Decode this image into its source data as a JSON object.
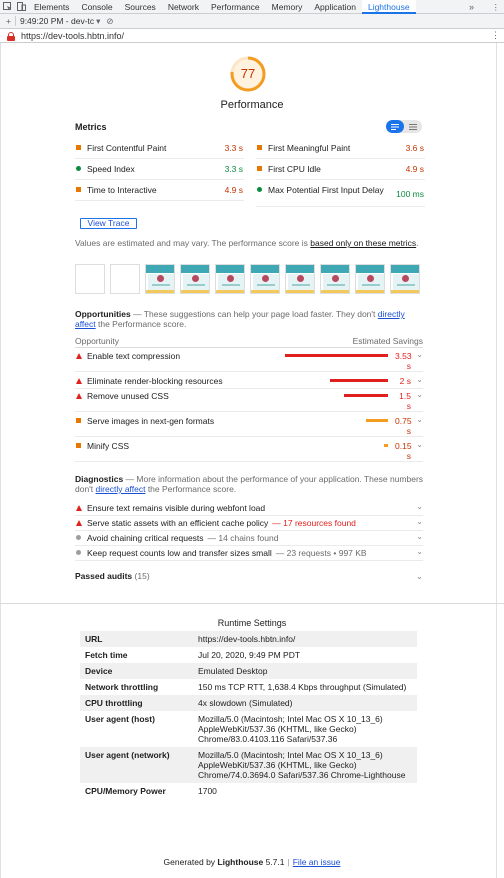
{
  "devtools": {
    "tabs": [
      "Elements",
      "Console",
      "Sources",
      "Network",
      "Performance",
      "Memory",
      "Application",
      "Lighthouse"
    ],
    "active_tab": "Lighthouse",
    "more_label": "»",
    "kebab": "⋮",
    "toolbar": {
      "plus": "+",
      "report": "9:49:20 PM - dev-tc",
      "dropdown": "▾",
      "clear": "⊘"
    },
    "url": "https://dev-tools.hbtn.info/"
  },
  "colors": {
    "accent": "#1a73e8",
    "red": "#e0201e",
    "orange": "#e67700",
    "green": "#0a8a3f"
  },
  "gauge": {
    "score": "77",
    "score_fraction": 0.77,
    "title": "Performance"
  },
  "metrics": {
    "header": "Metrics",
    "toggle_icons": [
      "list-view-icon",
      "table-view-icon"
    ],
    "items": [
      {
        "label": "First Contentful Paint",
        "value": "3.3 s",
        "status": "average"
      },
      {
        "label": "First Meaningful Paint",
        "value": "3.6 s",
        "status": "average"
      },
      {
        "label": "Speed Index",
        "value": "3.3 s",
        "status": "pass"
      },
      {
        "label": "First CPU Idle",
        "value": "4.9 s",
        "status": "average"
      },
      {
        "label": "Time to Interactive",
        "value": "4.9 s",
        "status": "average"
      },
      {
        "label": "Max Potential First Input Delay",
        "value": "100 ms",
        "status": "pass"
      }
    ],
    "view_trace": "View Trace",
    "disclaimer_prefix": "Values are estimated and may vary. The performance score is ",
    "disclaimer_link": "based only on these metrics",
    "disclaimer_suffix": "."
  },
  "filmstrip": {
    "blank_frames": 2,
    "screenshot_frames": 8
  },
  "opportunities": {
    "title": "Opportunities",
    "desc_prefix": " — These suggestions can help your page load faster. They don't ",
    "desc_link": "directly affect",
    "desc_suffix": " the Performance score.",
    "col_left": "Opportunity",
    "col_right": "Estimated Savings",
    "max_savings_s": 3.53,
    "items": [
      {
        "label": "Enable text compression",
        "savings_value": "3.53",
        "unit": "s",
        "seconds": 3.53,
        "severity": "fail"
      },
      {
        "label": "Eliminate render-blocking resources",
        "savings_value": "2 s",
        "unit": "",
        "seconds": 2,
        "severity": "fail"
      },
      {
        "label": "Remove unused CSS",
        "savings_value": "1.5",
        "unit": "s",
        "seconds": 1.5,
        "severity": "fail"
      },
      {
        "label": "Serve images in next-gen formats",
        "savings_value": "0.75",
        "unit": "s",
        "seconds": 0.75,
        "severity": "average"
      },
      {
        "label": "Minify CSS",
        "savings_value": "0.15",
        "unit": "s",
        "seconds": 0.15,
        "severity": "average"
      }
    ]
  },
  "diagnostics": {
    "title": "Diagnostics",
    "desc_prefix": " — More information about the performance of your application. These numbers don't ",
    "desc_link": "directly affect",
    "desc_suffix": " the Performance score.",
    "items": [
      {
        "label": "Ensure text remains visible during webfont load",
        "extra": "",
        "severity": "fail"
      },
      {
        "label": "Serve static assets with an efficient cache policy",
        "extra": "— 17 resources found",
        "severity": "fail"
      },
      {
        "label": "Avoid chaining critical requests",
        "extra": "— 14 chains found",
        "severity": "info"
      },
      {
        "label": "Keep request counts low and transfer sizes small",
        "extra": "— 23 requests • 997 KB",
        "severity": "info"
      }
    ]
  },
  "passed": {
    "label": "Passed audits",
    "count": "(15)"
  },
  "runtime": {
    "title": "Runtime Settings",
    "rows": [
      {
        "key": "URL",
        "value": "https://dev-tools.hbtn.info/"
      },
      {
        "key": "Fetch time",
        "value": "Jul 20, 2020, 9:49 PM PDT"
      },
      {
        "key": "Device",
        "value": "Emulated Desktop"
      },
      {
        "key": "Network throttling",
        "value": "150 ms TCP RTT, 1,638.4 Kbps throughput (Simulated)"
      },
      {
        "key": "CPU throttling",
        "value": "4x slowdown (Simulated)"
      },
      {
        "key": "User agent (host)",
        "value": "Mozilla/5.0 (Macintosh; Intel Mac OS X 10_13_6) AppleWebKit/537.36 (KHTML, like Gecko) Chrome/83.0.4103.116 Safari/537.36"
      },
      {
        "key": "User agent (network)",
        "value": "Mozilla/5.0 (Macintosh; Intel Mac OS X 10_13_6) AppleWebKit/537.36 (KHTML, like Gecko) Chrome/74.0.3694.0 Safari/537.36 Chrome-Lighthouse"
      },
      {
        "key": "CPU/Memory Power",
        "value": "1700"
      }
    ]
  },
  "footer": {
    "prefix": "Generated by ",
    "brand": "Lighthouse",
    "version": " 5.7.1",
    "sep": "|",
    "link": "File an issue"
  }
}
